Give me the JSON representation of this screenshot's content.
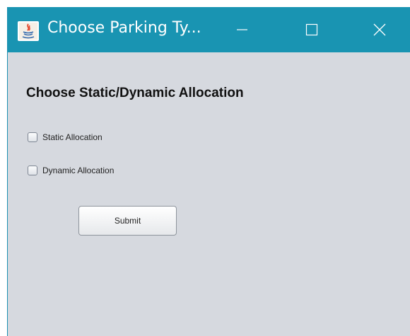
{
  "window": {
    "title": "Choose Parking Ty...",
    "titlebar_color": "#1994b2",
    "background_color": "#d6d9df",
    "controls": {
      "minimize_icon": "minimize-icon",
      "maximize_icon": "maximize-icon",
      "close_icon": "close-icon"
    },
    "app_icon": "java-icon"
  },
  "form": {
    "heading": "Choose Static/Dynamic Allocation",
    "options": [
      {
        "label": "Static Allocation",
        "checked": false
      },
      {
        "label": "Dynamic Allocation",
        "checked": false
      }
    ],
    "submit_label": "Submit"
  }
}
